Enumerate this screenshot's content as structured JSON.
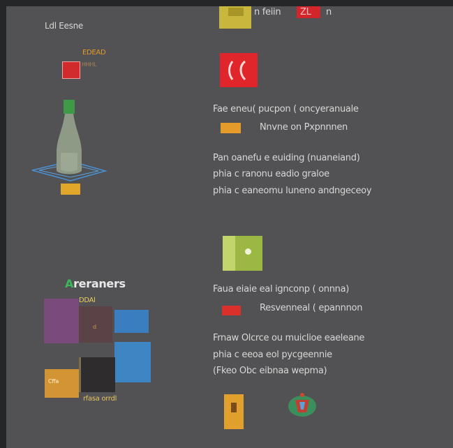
{
  "top": {
    "caption": "n feiin",
    "badge": "ZL",
    "tail": "n"
  },
  "left_upper": {
    "title": "Ldl Eesne",
    "tag": "EDEAD",
    "sub": "HHHL"
  },
  "left_lower": {
    "title": "Areraners",
    "box_label": "DDAl",
    "footer": "rfasa orrdl",
    "card_small": "d"
  },
  "section1": {
    "line1": "Fae eneu( pucpon ( oncyeranuale",
    "line2": "Nnvne on Pxpnnnen",
    "line3": "Pan oanefu e euiding (nuaneiand)",
    "line4": "phia c ranonu eadio graloe",
    "line5": "phia c eaneomu luneno andngeceoy"
  },
  "section2": {
    "line1": "Faua eiaie eal ignconp ( onnna)",
    "line2": "Resvenneal ( epannnon",
    "line3": "Frnaw Olcrce ou muiclioe eaeleane",
    "line4": "phia c eeoa eol pycgeennie",
    "line5": "(Fkeo  Obc eibnaa wepma)"
  },
  "colors": {
    "background": "#525254",
    "frame": "#252627",
    "red": "#e0262b",
    "yellow": "#c8b83a",
    "orange": "#e39a2a",
    "green_olive": "#9bb843",
    "blue": "#3d7fbf",
    "purple": "#7a4a7a"
  }
}
